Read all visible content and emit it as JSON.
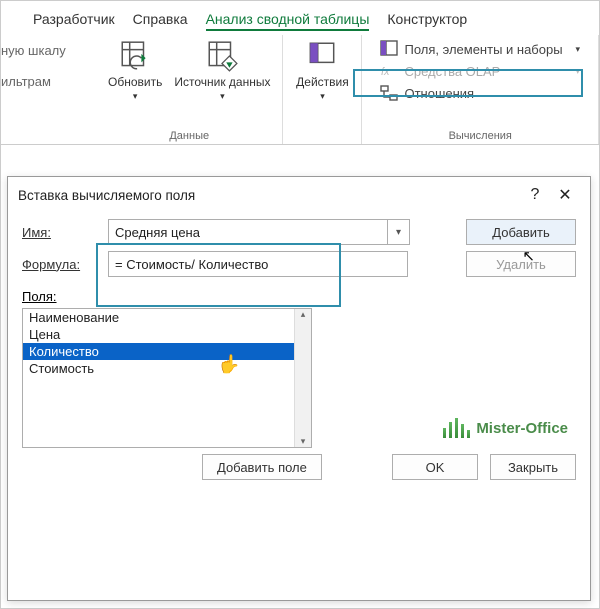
{
  "tabs": {
    "developer": "Разработчик",
    "help": "Справка",
    "analyze": "Анализ сводной таблицы",
    "design": "Конструктор"
  },
  "ribbon": {
    "left_frag_1": "ную шкалу",
    "left_frag_2": "ильтрам",
    "refresh": "Обновить",
    "source": "Источник данных",
    "group_data": "Данные",
    "actions": "Действия",
    "fields_items_sets": "Поля, элементы и наборы",
    "olap_tools": "Средства OLAP",
    "relationships": "Отношения",
    "group_calc": "Вычисления"
  },
  "dialog": {
    "title": "Вставка вычисляемого поля",
    "help_icon": "?",
    "close_icon": "✕",
    "name_label": "Имя:",
    "name_value": "Средняя цена",
    "formula_label": "Формула:",
    "formula_value": "= Стоимость/ Количество",
    "add_btn": "Добавить",
    "delete_btn": "Удалить",
    "fields_label": "Поля:",
    "fields": [
      "Наименование",
      "Цена",
      "Количество",
      "Стоимость"
    ],
    "selected_field_index": 2,
    "add_field_btn": "Добавить поле",
    "ok": "OK",
    "close": "Закрыть"
  },
  "watermark": "Mister-Office"
}
